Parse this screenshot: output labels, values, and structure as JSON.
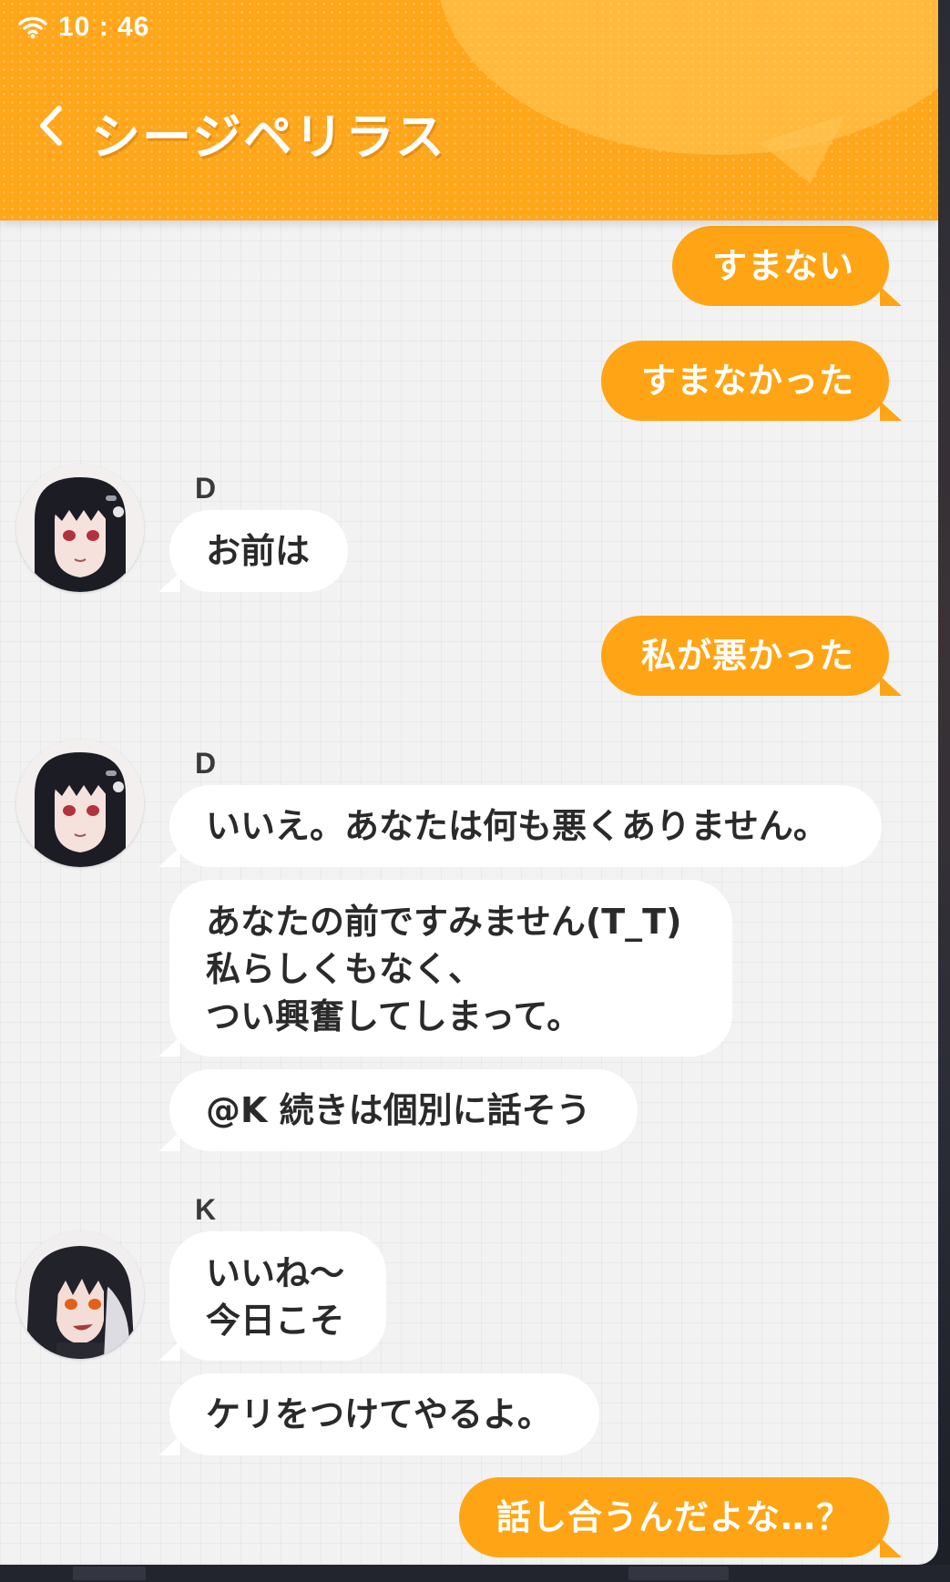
{
  "status_bar": {
    "time": "10 : 46",
    "wifi_icon": "wifi-icon"
  },
  "header": {
    "back_icon": "chevron-left-icon",
    "title": "シージペリラス",
    "accent_color": "#ffa61a"
  },
  "colors": {
    "outgoing_bubble": "#ffa515",
    "incoming_bubble": "#ffffff",
    "background": "#f2f2f3"
  },
  "messages": [
    {
      "id": "m1",
      "direction": "outgoing",
      "text": "すまない"
    },
    {
      "id": "m2",
      "direction": "outgoing",
      "text": "すまなかった"
    },
    {
      "id": "m3",
      "direction": "incoming",
      "sender": "D",
      "avatar": "avatar-d-icon",
      "text": "お前は"
    },
    {
      "id": "m4",
      "direction": "outgoing",
      "text": "私が悪かった"
    },
    {
      "id": "m5",
      "direction": "incoming",
      "sender": "D",
      "avatar": "avatar-d-icon",
      "text": "いいえ。あなたは何も悪くありません。"
    },
    {
      "id": "m6",
      "direction": "incoming",
      "sender": "D",
      "lines": [
        "あなたの前ですみません(T_T)",
        "私らしくもなく、",
        "つい興奮してしまって。"
      ]
    },
    {
      "id": "m7",
      "direction": "incoming",
      "sender": "D",
      "text": "@K 続きは個別に話そう"
    },
    {
      "id": "m8",
      "direction": "incoming",
      "sender": "K",
      "avatar": "avatar-k-icon",
      "lines": [
        "いいね～",
        "今日こそ"
      ]
    },
    {
      "id": "m9",
      "direction": "incoming",
      "sender": "K",
      "text": "ケリをつけてやるよ。"
    },
    {
      "id": "m10",
      "direction": "outgoing",
      "text": "話し合うんだよな…？"
    }
  ]
}
